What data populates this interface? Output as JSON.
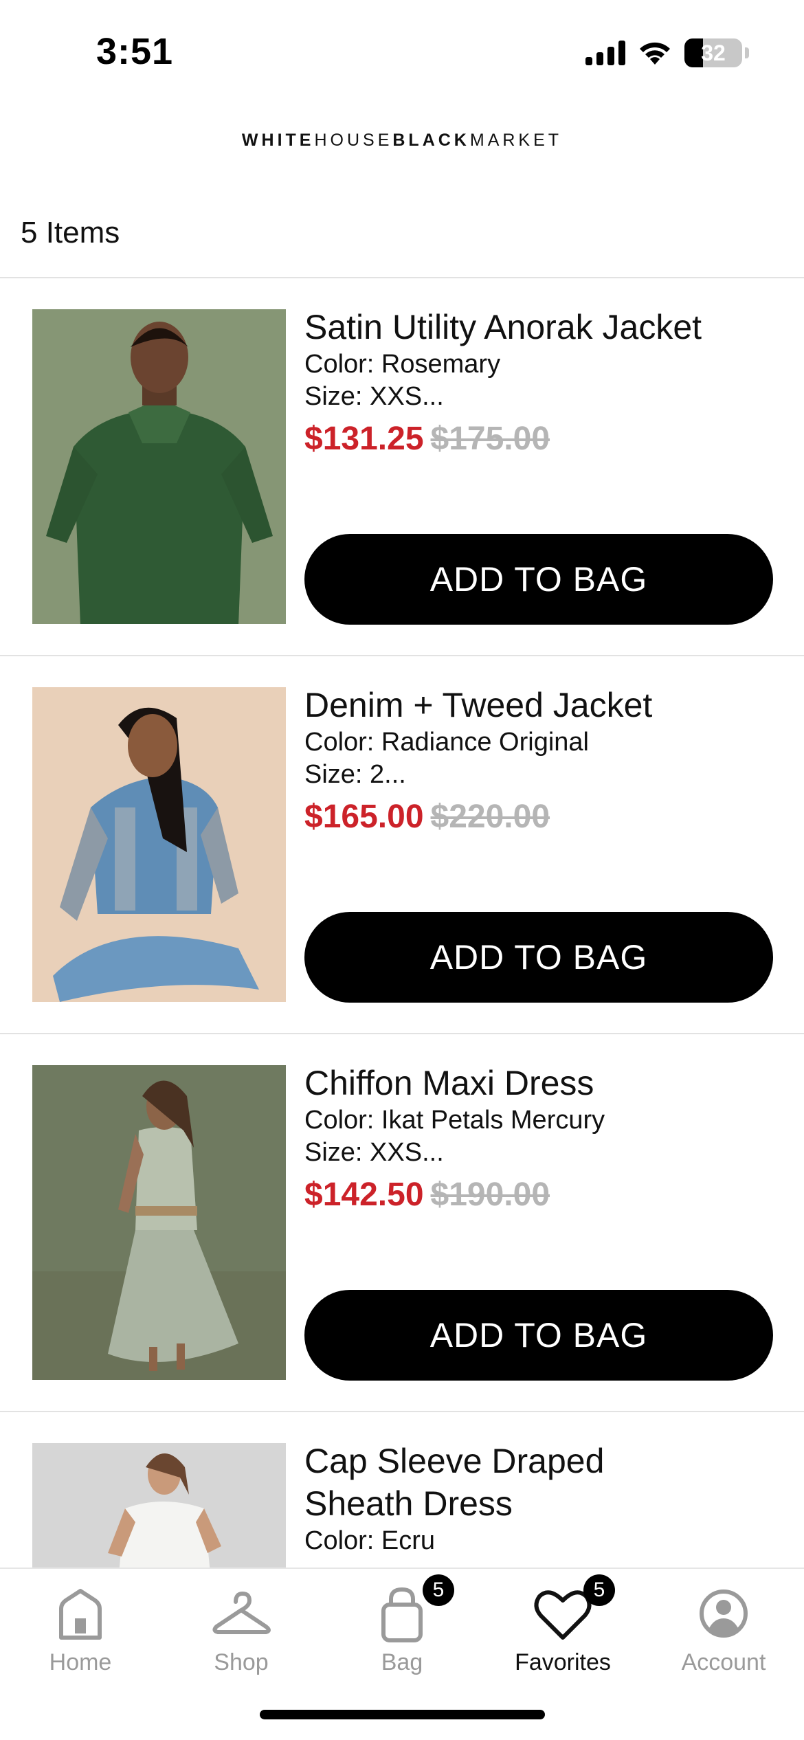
{
  "status_bar": {
    "time": "3:51",
    "battery": "32",
    "battery_level": 0.32
  },
  "brand": {
    "part1": "WHITE",
    "part2": "HOUSE",
    "part3": "BLACK",
    "part4": "MARKET"
  },
  "item_count": "5 Items",
  "products": [
    {
      "name": "Satin Utility Anorak Jacket",
      "color": "Color: Rosemary",
      "size": "Size: XXS...",
      "sale_price": "$131.25",
      "original_price": "$175.00",
      "button": "ADD TO BAG"
    },
    {
      "name": "Denim + Tweed Jacket",
      "color": "Color: Radiance Original",
      "size": "Size: 2...",
      "sale_price": "$165.00",
      "original_price": "$220.00",
      "button": "ADD TO BAG"
    },
    {
      "name": "Chiffon Maxi Dress",
      "color": "Color: Ikat Petals Mercury",
      "size": "Size: XXS...",
      "sale_price": "$142.50",
      "original_price": "$190.00",
      "button": "ADD TO BAG"
    },
    {
      "name_line1": "Cap Sleeve Draped",
      "name_line2": "Sheath Dress",
      "color": "Color: Ecru"
    }
  ],
  "tabs": [
    {
      "label": "Home",
      "icon": "home-icon"
    },
    {
      "label": "Shop",
      "icon": "hanger-icon"
    },
    {
      "label": "Bag",
      "icon": "bag-icon",
      "badge": "5"
    },
    {
      "label": "Favorites",
      "icon": "heart-icon",
      "badge": "5",
      "active": true
    },
    {
      "label": "Account",
      "icon": "account-icon"
    }
  ],
  "colors": {
    "sale": "#cc2229",
    "original_price": "#b5b5b5",
    "button": "#000000",
    "tab_inactive": "#9a9a9a"
  }
}
